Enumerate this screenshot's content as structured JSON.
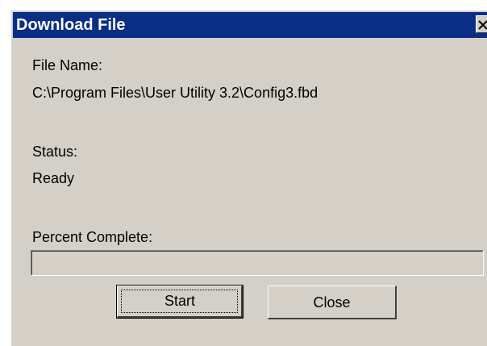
{
  "window": {
    "title": "Download File"
  },
  "file": {
    "label": "File Name:",
    "path": "C:\\Program Files\\User Utility 3.2\\Config3.fbd"
  },
  "status": {
    "label": "Status:",
    "value": "Ready"
  },
  "progress": {
    "label": "Percent Complete:",
    "percent": 0
  },
  "buttons": {
    "start_label": "Start",
    "close_label": "Close"
  },
  "colors": {
    "title_bar": "#0a2d86",
    "dialog_face": "#d4d0c8"
  },
  "icons": {
    "close": "close-icon"
  }
}
